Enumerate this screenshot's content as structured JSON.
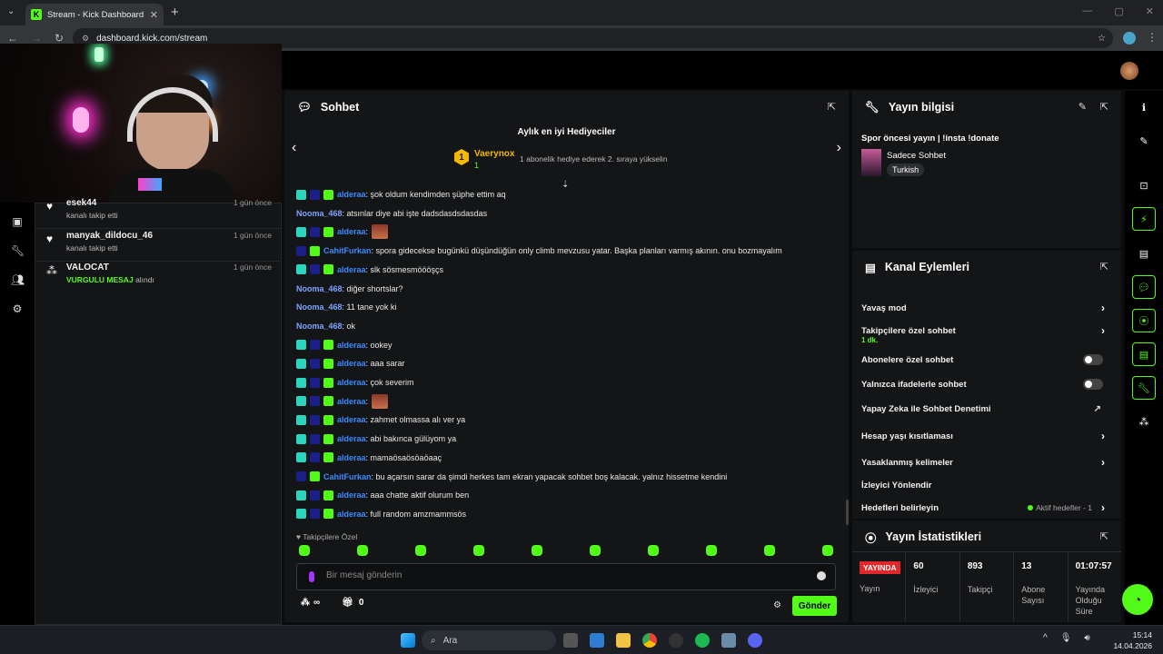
{
  "browser": {
    "tab_title": "Stream - Kick Dashboard",
    "new_tab": "+",
    "url": "dashboard.kick.com/stream"
  },
  "activity": {
    "items": [
      {
        "name": "esek44",
        "sub": "kanalı takip etti",
        "time": "1 gün önce",
        "icon": "heart-icon"
      },
      {
        "name": "manyak_dildocu_46",
        "sub": "kanalı takip etti",
        "time": "1 gün önce",
        "icon": "heart-icon"
      },
      {
        "name": "VALOCAT",
        "sub_highlight": "VURGULU MESAJ",
        "sub": "alındı",
        "time": "1 gün önce",
        "icon": "highlight-icon"
      }
    ]
  },
  "chat": {
    "title": "Sohbet",
    "gifters_title": "Aylık en iyi Hediyeciler",
    "top_gifter": {
      "rank": "1",
      "name": "Vaerynox",
      "count": "1"
    },
    "gifter_info": "1 abonelik hediye ederek 2. sıraya yükselin",
    "messages": [
      {
        "user": "alderaa",
        "text": ": şok oldum kendimden şüphe ettim aq",
        "badges": 3,
        "color": "blue"
      },
      {
        "user": "Nooma_468",
        "text": ": atsınlar diye abi işte dadsdasdsdasdas",
        "badges": 0,
        "color": "lblue"
      },
      {
        "user": "alderaa",
        "text": ":",
        "badges": 3,
        "color": "blue",
        "emote": true
      },
      {
        "user": "CahitFurkan",
        "text": ": spora gidecekse bugünkü düşündüğün only climb mevzusu yatar. Başka planları varmış akının. onu bozmayalım",
        "badges": 2,
        "color": "blue"
      },
      {
        "user": "alderaa",
        "text": ": slk sösmesmöööşçs",
        "badges": 3,
        "color": "blue"
      },
      {
        "user": "Nooma_468",
        "text": ": diğer shortslar?",
        "badges": 0,
        "color": "lblue"
      },
      {
        "user": "Nooma_468",
        "text": ": 11 tane yok ki",
        "badges": 0,
        "color": "lblue"
      },
      {
        "user": "Nooma_468",
        "text": ": ok",
        "badges": 0,
        "color": "lblue"
      },
      {
        "user": "alderaa",
        "text": ": ookey",
        "badges": 3,
        "color": "blue"
      },
      {
        "user": "alderaa",
        "text": ": aaa sarar",
        "badges": 3,
        "color": "blue"
      },
      {
        "user": "alderaa",
        "text": ": çok severim",
        "badges": 3,
        "color": "blue"
      },
      {
        "user": "alderaa",
        "text": ":",
        "badges": 3,
        "color": "blue",
        "emote": true
      },
      {
        "user": "alderaa",
        "text": ": zahmet olmassa alı ver ya",
        "badges": 3,
        "color": "blue"
      },
      {
        "user": "alderaa",
        "text": ": abi bakınca gülüyom ya",
        "badges": 3,
        "color": "blue"
      },
      {
        "user": "alderaa",
        "text": ": mamaösaösöaöaaç",
        "badges": 3,
        "color": "blue"
      },
      {
        "user": "CahitFurkan",
        "text": ": bu açarsın sarar da şimdi herkes tam ekran yapacak sohbet boş kalacak. yalnız hissetme kendini",
        "badges": 2,
        "color": "blue"
      },
      {
        "user": "alderaa",
        "text": ": aaa chatte aktif olurum ben",
        "badges": 3,
        "color": "blue"
      },
      {
        "user": "alderaa",
        "text": ": full random amzmammsös",
        "badges": 3,
        "color": "blue"
      }
    ],
    "follower_only": "♥ Takipçilere Özel",
    "input_placeholder": "Bir mesaj gönderin",
    "infinity": "∞",
    "gift_count": "0",
    "send_label": "Gönder"
  },
  "stream_info": {
    "title": "Yayın bilgisi",
    "stream_title": "Spor öncesi yayın | !insta !donate",
    "category": "Sadece Sohbet",
    "tag": "Turkish"
  },
  "channel_actions": {
    "title": "Kanal Eylemleri",
    "items": [
      {
        "label": "Yavaş mod",
        "type": "chevron"
      },
      {
        "label": "Takipçilere özel sohbet",
        "sub": "1 dk.",
        "type": "chevron"
      },
      {
        "label": "Abonelere özel sohbet",
        "type": "toggle"
      },
      {
        "label": "Yalnızca ifadelerle sohbet",
        "type": "toggle"
      },
      {
        "label": "Yapay Zeka ile Sohbet Denetimi",
        "type": "external"
      },
      {
        "label": "Hesap yaşı kısıtlaması",
        "type": "chevron"
      },
      {
        "label": "Yasaklanmış kelimeler",
        "type": "chevron"
      },
      {
        "label": "İzleyici Yönlendir",
        "type": "none"
      },
      {
        "label": "Hedefleri belirleyin",
        "type": "chevron",
        "extra": "Aktif hedefler - 1"
      }
    ]
  },
  "stats": {
    "title": "Yayın İstatistikleri",
    "live_badge": "YAYINDA",
    "cols": [
      {
        "value": "",
        "label": "Yayın"
      },
      {
        "value": "60",
        "label": "İzleyici"
      },
      {
        "value": "893",
        "label": "Takipçi"
      },
      {
        "value": "13",
        "label": "Abone Sayısı"
      },
      {
        "value": "01:07:57",
        "label": "Yayında Olduğu Süre"
      }
    ]
  },
  "taskbar": {
    "search": "Ara",
    "time": "15:14",
    "date": "14.04.2026"
  },
  "colors": {
    "accent": "#53fc18",
    "gold": "#f5b800",
    "live": "#e0272a"
  }
}
